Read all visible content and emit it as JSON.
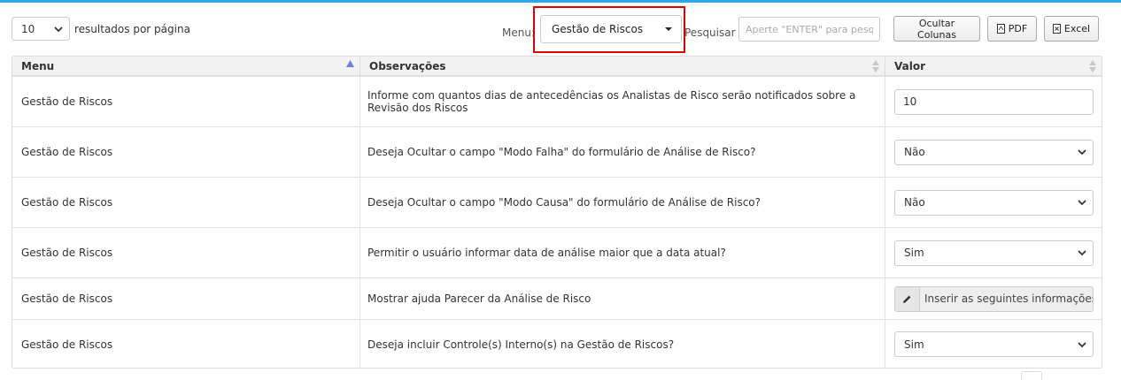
{
  "toolbar": {
    "per_page_value": "10",
    "per_page_label": "resultados por página",
    "menu_label": "Menu:",
    "menu_selected": "Gestão de Riscos",
    "search_label": "Pesquisar",
    "search_placeholder": "Aperte \"ENTER\" para pesquisar",
    "btn_hide_columns": "Ocultar Colunas",
    "btn_pdf": "PDF",
    "btn_excel": "Excel"
  },
  "colors": {
    "accent_bar": "#29a9e8",
    "highlight_border": "#e00000",
    "sort_arrow": "#6f7fd6"
  },
  "table": {
    "headers": {
      "menu": "Menu",
      "observacoes": "Observações",
      "valor": "Valor"
    },
    "rows": [
      {
        "menu": "Gestão de Riscos",
        "obs": "Informe com quantos dias de antecedências os Analistas de Risco serão notificados sobre a Revisão dos Riscos",
        "valor": "10"
      },
      {
        "menu": "Gestão de Riscos",
        "obs": "Deseja Ocultar o campo \"Modo Falha\" do formulário de Análise de Risco?",
        "valor": "Não"
      },
      {
        "menu": "Gestão de Riscos",
        "obs": "Deseja Ocultar o campo \"Modo Causa\" do formulário de Análise de Risco?",
        "valor": "Não"
      },
      {
        "menu": "Gestão de Riscos",
        "obs": "Permitir o usuário informar data de análise maior que a data atual?",
        "valor": "Sim"
      },
      {
        "menu": "Gestão de Riscos",
        "obs": "Mostrar ajuda Parecer da Análise de Risco",
        "valor": "Inserir as seguintes informações: J"
      },
      {
        "menu": "Gestão de Riscos",
        "obs": "Deseja incluir Controle(s) Interno(s) na Gestão de Riscos?",
        "valor": "Sim"
      }
    ]
  }
}
